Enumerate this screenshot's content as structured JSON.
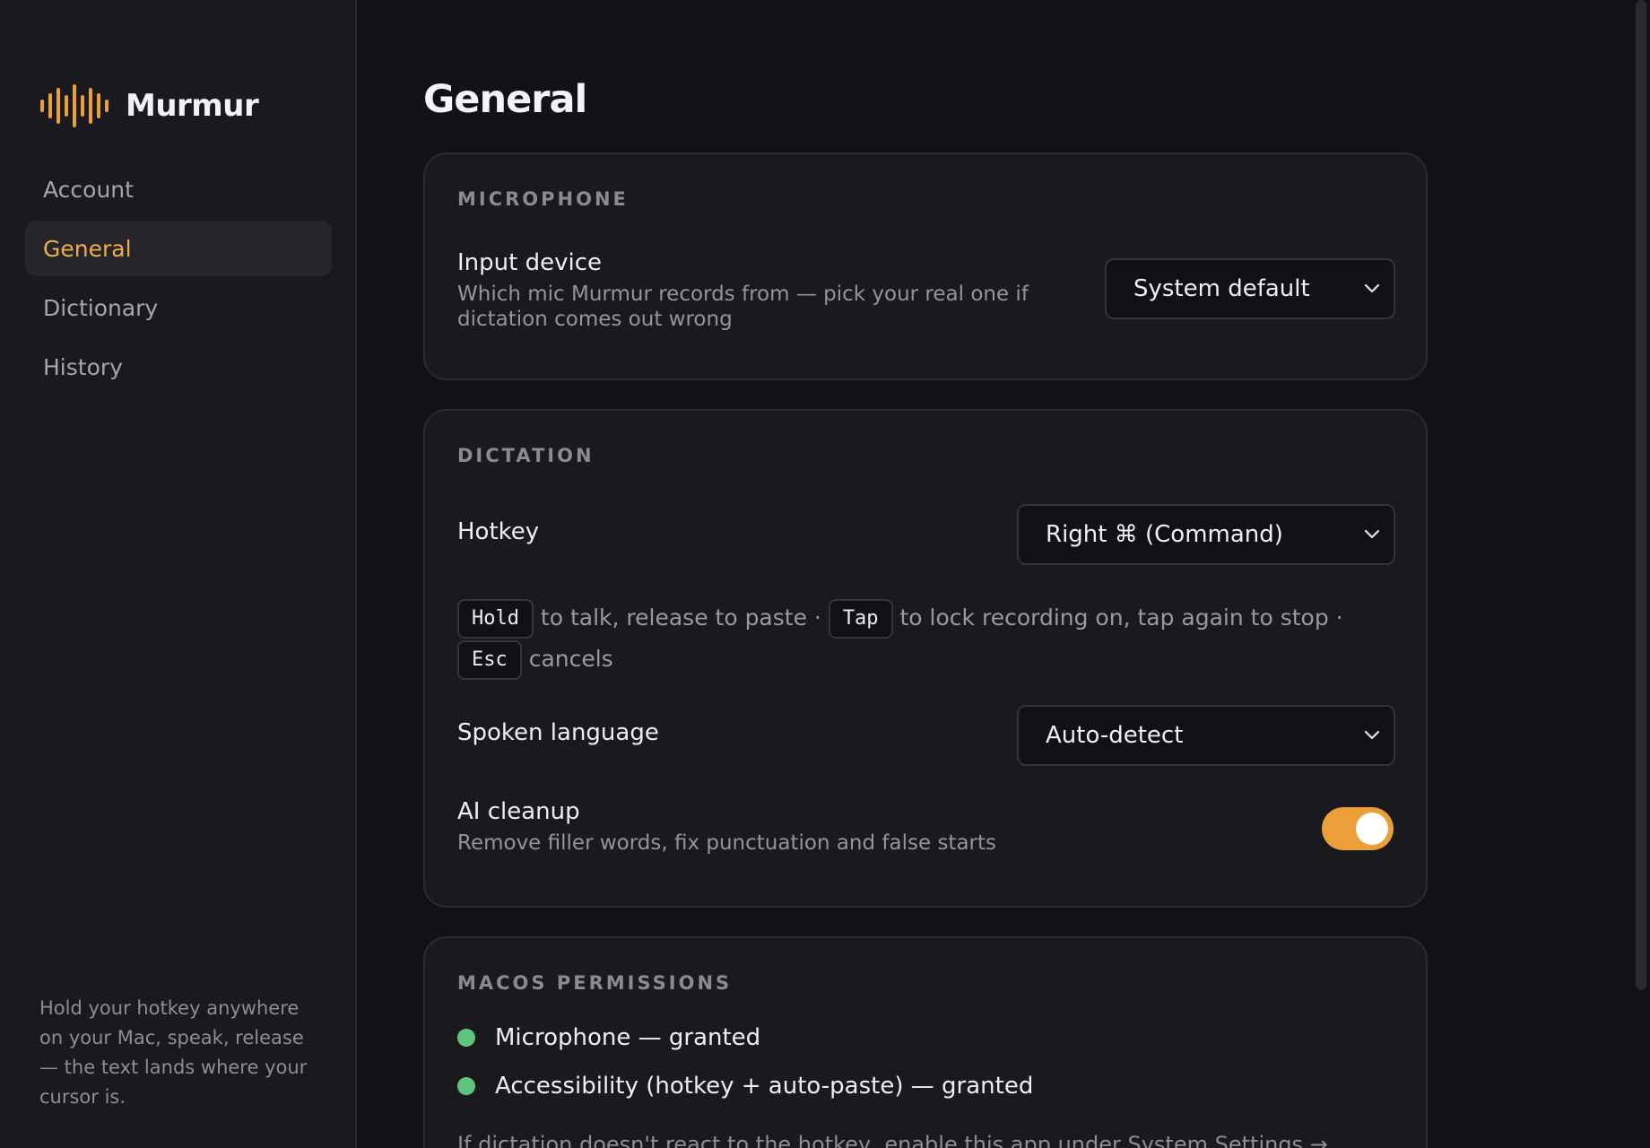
{
  "app": {
    "name": "Murmur",
    "accent": "#ea9f39",
    "success": "#5ec47e"
  },
  "sidebar": {
    "items": [
      {
        "label": "Account",
        "active": false
      },
      {
        "label": "General",
        "active": true
      },
      {
        "label": "Dictionary",
        "active": false
      },
      {
        "label": "History",
        "active": false
      }
    ],
    "footer": "Hold your hotkey anywhere on your Mac, speak, release — the text lands where your cursor is."
  },
  "page": {
    "title": "General"
  },
  "microphone": {
    "section": "MICROPHONE",
    "label": "Input device",
    "description": "Which mic Murmur records from — pick your real one if dictation comes out wrong",
    "value": "System default"
  },
  "dictation": {
    "section": "DICTATION",
    "hotkey": {
      "label": "Hotkey",
      "value": "Right ⌘ (Command)"
    },
    "hint": {
      "k1": "Hold",
      "t1": " to talk, release to paste · ",
      "k2": "Tap",
      "t2": " to lock recording on, tap again to stop · ",
      "k3": "Esc",
      "t3": " cancels"
    },
    "language": {
      "label": "Spoken language",
      "value": "Auto-detect"
    },
    "ai_cleanup": {
      "label": "AI cleanup",
      "description": "Remove filler words, fix punctuation and false starts",
      "enabled": true
    }
  },
  "permissions": {
    "section": "MACOS PERMISSIONS",
    "items": [
      {
        "label": "Microphone — granted",
        "status": "granted"
      },
      {
        "label": "Accessibility (hotkey + auto-paste) — granted",
        "status": "granted"
      }
    ],
    "note": "If dictation doesn't react to the hotkey, enable this app under System Settings →"
  }
}
